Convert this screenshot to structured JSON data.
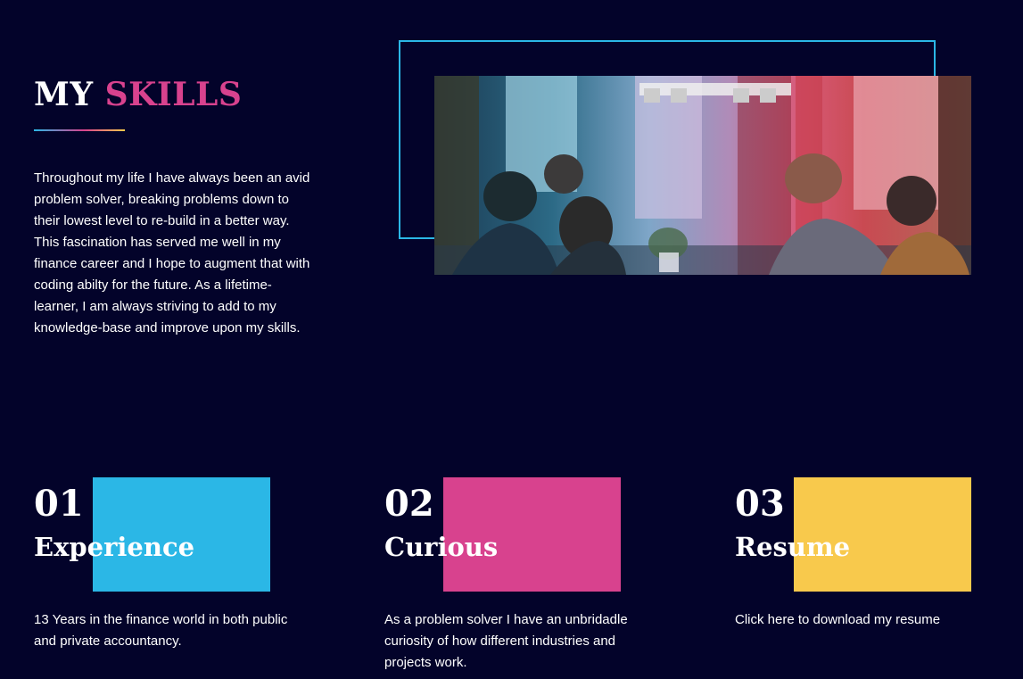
{
  "skills": {
    "title_part1": "MY",
    "title_part2": "SKILLS",
    "intro": "Throughout my life I have always been an avid problem solver, breaking problems down to their lowest level to re-build in a better way. This fascination has served me well in my finance career and I hope to augment that with coding abilty for the future. As a lifetime-learner, I am always striving to add to my knowledge-base and improve upon my skills."
  },
  "cards": [
    {
      "number": "01",
      "title": "Experience",
      "description": "13 Years in the finance world in both public and private accountancy.",
      "color": "#2bb7e6"
    },
    {
      "number": "02",
      "title": "Curious",
      "description": "As a problem solver I have an unbridadle curiosity of how different industries and projects work.",
      "color": "#d8428e"
    },
    {
      "number": "03",
      "title": "Resume",
      "description": "Click here to download my resume",
      "color": "#f8c94c"
    }
  ],
  "colors": {
    "background": "#03032a",
    "accent_pink": "#d8428e",
    "accent_blue": "#2bb7e6",
    "accent_yellow": "#f8c94c"
  }
}
